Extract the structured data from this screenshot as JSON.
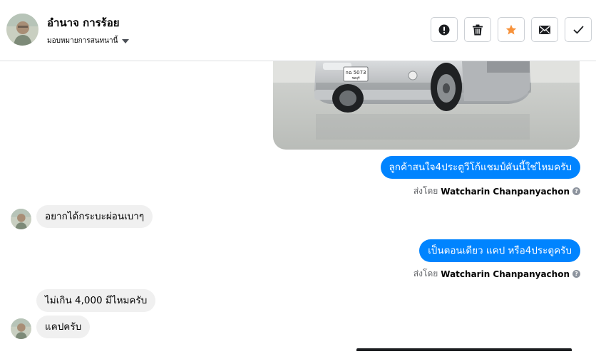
{
  "contact": {
    "name": "อำนาจ การร้อย",
    "assign_label": "มอบหมายการสนทนานี้"
  },
  "actions": [
    {
      "name": "mark-spam-button",
      "icon": "exclamation-icon",
      "color": "#1c1e21"
    },
    {
      "name": "delete-button",
      "icon": "trash-icon",
      "color": "#1c1e21"
    },
    {
      "name": "star-button",
      "icon": "star-icon",
      "color": "#f7923b"
    },
    {
      "name": "mark-unread-button",
      "icon": "envelope-icon",
      "color": "#1c1e21"
    },
    {
      "name": "mark-done-button",
      "icon": "check-icon",
      "color": "#1c1e21"
    }
  ],
  "photo": {
    "plate_line1": "กฉ 5073",
    "plate_line2": "ชลบุรี"
  },
  "messages": {
    "out1": "ลูกค้าสนใจ4ประตูวีโก้แชมป์คันนี้ใช่ไหมครับ",
    "in1": "อยากได้กระบะผ่อนเบาๆ",
    "out2": "เป็นตอนเดียว แคป หรือ4ประตูครับ",
    "in2": "ไม่เกิน 4,000 มีไหมครับ",
    "in3": "แคปครับ"
  },
  "sent_by": {
    "prefix": "ส่งโดย",
    "agent": "Watcharin Chanpanyachon",
    "help": "?"
  },
  "colors": {
    "outgoing_bubble": "#0084ff",
    "incoming_bubble": "#f0f0f0",
    "accent_star": "#f7923b"
  }
}
